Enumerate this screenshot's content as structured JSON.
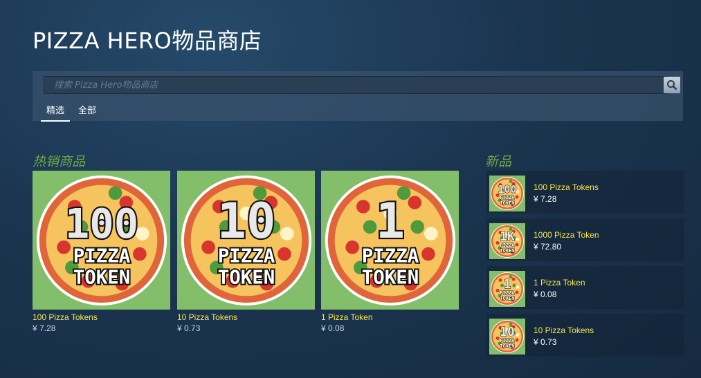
{
  "store": {
    "title": "PIZZA HERO物品商店",
    "search_placeholder": "搜索 Pizza Hero物品商店",
    "tabs": [
      "精选",
      "全部"
    ]
  },
  "bestsellers": {
    "heading": "热销商品",
    "items": [
      {
        "name": "100 Pizza Tokens",
        "price": "¥ 7.28",
        "badge": "100"
      },
      {
        "name": "10 Pizza Tokens",
        "price": "¥ 0.73",
        "badge": "10"
      },
      {
        "name": "1 Pizza Token",
        "price": "¥ 0.08",
        "badge": "1"
      }
    ]
  },
  "new_items": {
    "heading": "新品",
    "items": [
      {
        "name": "100 Pizza Tokens",
        "price": "¥ 7.28",
        "badge": "100"
      },
      {
        "name": "1000 Pizza Token",
        "price": "¥ 72.80",
        "badge": "1K"
      },
      {
        "name": "1 Pizza Token",
        "price": "¥ 0.08",
        "badge": "1"
      },
      {
        "name": "10 Pizza Tokens",
        "price": "¥ 0.73",
        "badge": "10"
      }
    ]
  },
  "token_image_label": [
    "PIZZA",
    "TOKEN"
  ],
  "colors": {
    "accent_green": "#6fa745",
    "item_name": "#f5e64e",
    "tile_bg": "#83bf6b"
  },
  "icons": {
    "search": "search-icon"
  }
}
